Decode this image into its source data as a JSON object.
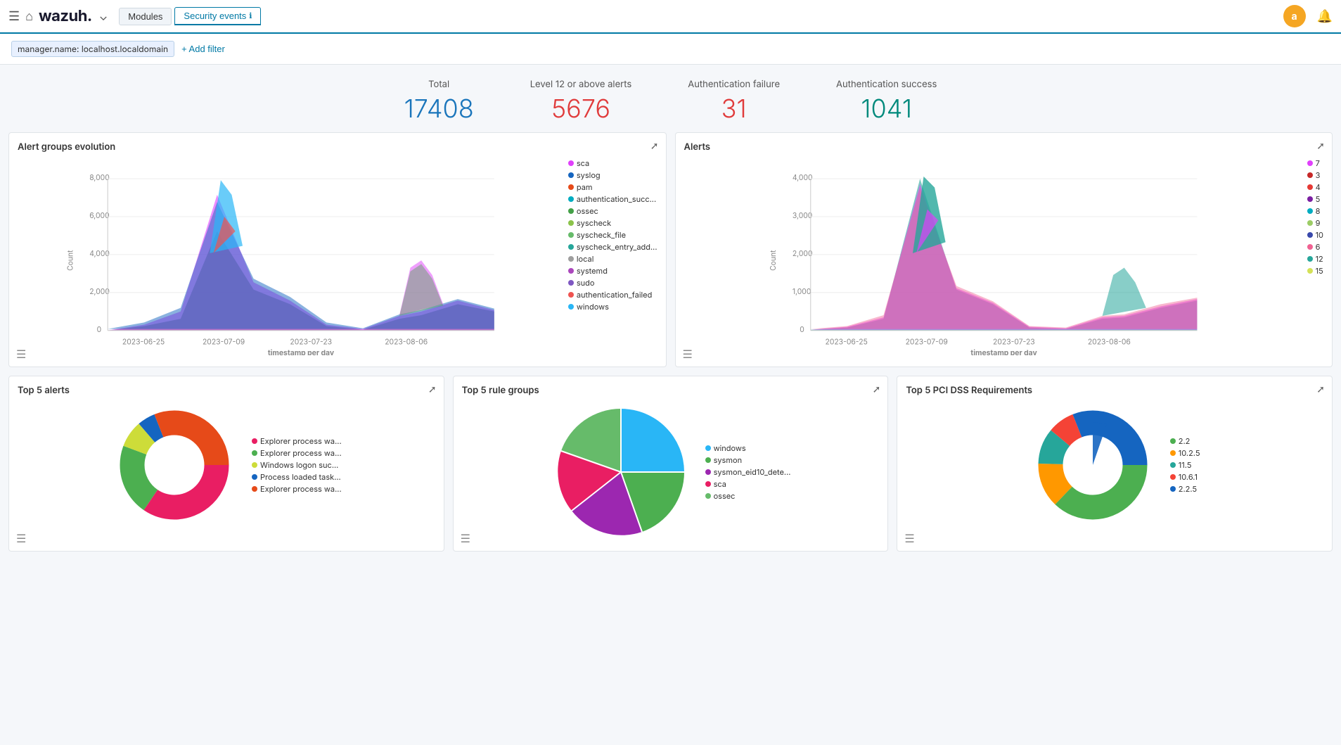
{
  "nav": {
    "logo": "wazuh.",
    "modules_label": "Modules",
    "active_tab": "Security events",
    "avatar_letter": "a"
  },
  "filter": {
    "tag": "manager.name: localhost.localdomain",
    "add_label": "+ Add filter"
  },
  "stats": {
    "total_label": "Total",
    "total_value": "17408",
    "level12_label": "Level 12 or above alerts",
    "level12_value": "5676",
    "auth_fail_label": "Authentication failure",
    "auth_fail_value": "31",
    "auth_success_label": "Authentication success",
    "auth_success_value": "1041"
  },
  "panels": {
    "alert_groups_title": "Alert groups evolution",
    "alerts_title": "Alerts",
    "top5alerts_title": "Top 5 alerts",
    "top5rulegroups_title": "Top 5 rule groups",
    "top5pci_title": "Top 5 PCI DSS Requirements"
  },
  "legend_alert_groups": [
    {
      "label": "sca",
      "color": "#e040fb"
    },
    {
      "label": "syslog",
      "color": "#1565c0"
    },
    {
      "label": "pam",
      "color": "#e64a19"
    },
    {
      "label": "authentication_succ...",
      "color": "#00acc1"
    },
    {
      "label": "ossec",
      "color": "#43a047"
    },
    {
      "label": "syscheck",
      "color": "#8bc34a"
    },
    {
      "label": "syscheck_file",
      "color": "#66bb6a"
    },
    {
      "label": "syscheck_entry_add...",
      "color": "#26a69a"
    },
    {
      "label": "local",
      "color": "#9e9e9e"
    },
    {
      "label": "systemd",
      "color": "#ab47bc"
    },
    {
      "label": "sudo",
      "color": "#7e57c2"
    },
    {
      "label": "authentication_failed",
      "color": "#ef5350"
    },
    {
      "label": "windows",
      "color": "#29b6f6"
    }
  ],
  "legend_alerts": [
    {
      "label": "7",
      "color": "#e040fb"
    },
    {
      "label": "3",
      "color": "#c62828"
    },
    {
      "label": "4",
      "color": "#e53935"
    },
    {
      "label": "5",
      "color": "#7b1fa2"
    },
    {
      "label": "8",
      "color": "#00acc1"
    },
    {
      "label": "9",
      "color": "#9ccc65"
    },
    {
      "label": "10",
      "color": "#3949ab"
    },
    {
      "label": "6",
      "color": "#f06292"
    },
    {
      "label": "12",
      "color": "#26a69a"
    },
    {
      "label": "15",
      "color": "#d4e157"
    }
  ],
  "legend_top5alerts": [
    {
      "label": "Explorer process wa...",
      "color": "#e91e63"
    },
    {
      "label": "Explorer process wa...",
      "color": "#4caf50"
    },
    {
      "label": "Windows logon suc...",
      "color": "#cddc39"
    },
    {
      "label": "Process loaded task...",
      "color": "#1565c0"
    },
    {
      "label": "Explorer process wa...",
      "color": "#e64a19"
    }
  ],
  "legend_top5rulegroups": [
    {
      "label": "windows",
      "color": "#29b6f6"
    },
    {
      "label": "sysmon",
      "color": "#4caf50"
    },
    {
      "label": "sysmon_eid10_dete...",
      "color": "#9c27b0"
    },
    {
      "label": "sca",
      "color": "#e91e63"
    },
    {
      "label": "ossec",
      "color": "#66bb6a"
    }
  ],
  "legend_top5pci": [
    {
      "label": "2.2",
      "color": "#4caf50"
    },
    {
      "label": "10.2.5",
      "color": "#ff9800"
    },
    {
      "label": "11.5",
      "color": "#26a69a"
    },
    {
      "label": "10.6.1",
      "color": "#f44336"
    },
    {
      "label": "2.2.5",
      "color": "#1565c0"
    }
  ],
  "x_axis_labels": [
    "2023-06-25",
    "2023-07-09",
    "2023-07-23",
    "2023-08-06"
  ],
  "y_axis_alert_groups": [
    "8,000",
    "6,000",
    "4,000",
    "2,000",
    "0"
  ],
  "y_axis_alerts": [
    "4,000",
    "3,000",
    "2,000",
    "1,000",
    "0"
  ]
}
